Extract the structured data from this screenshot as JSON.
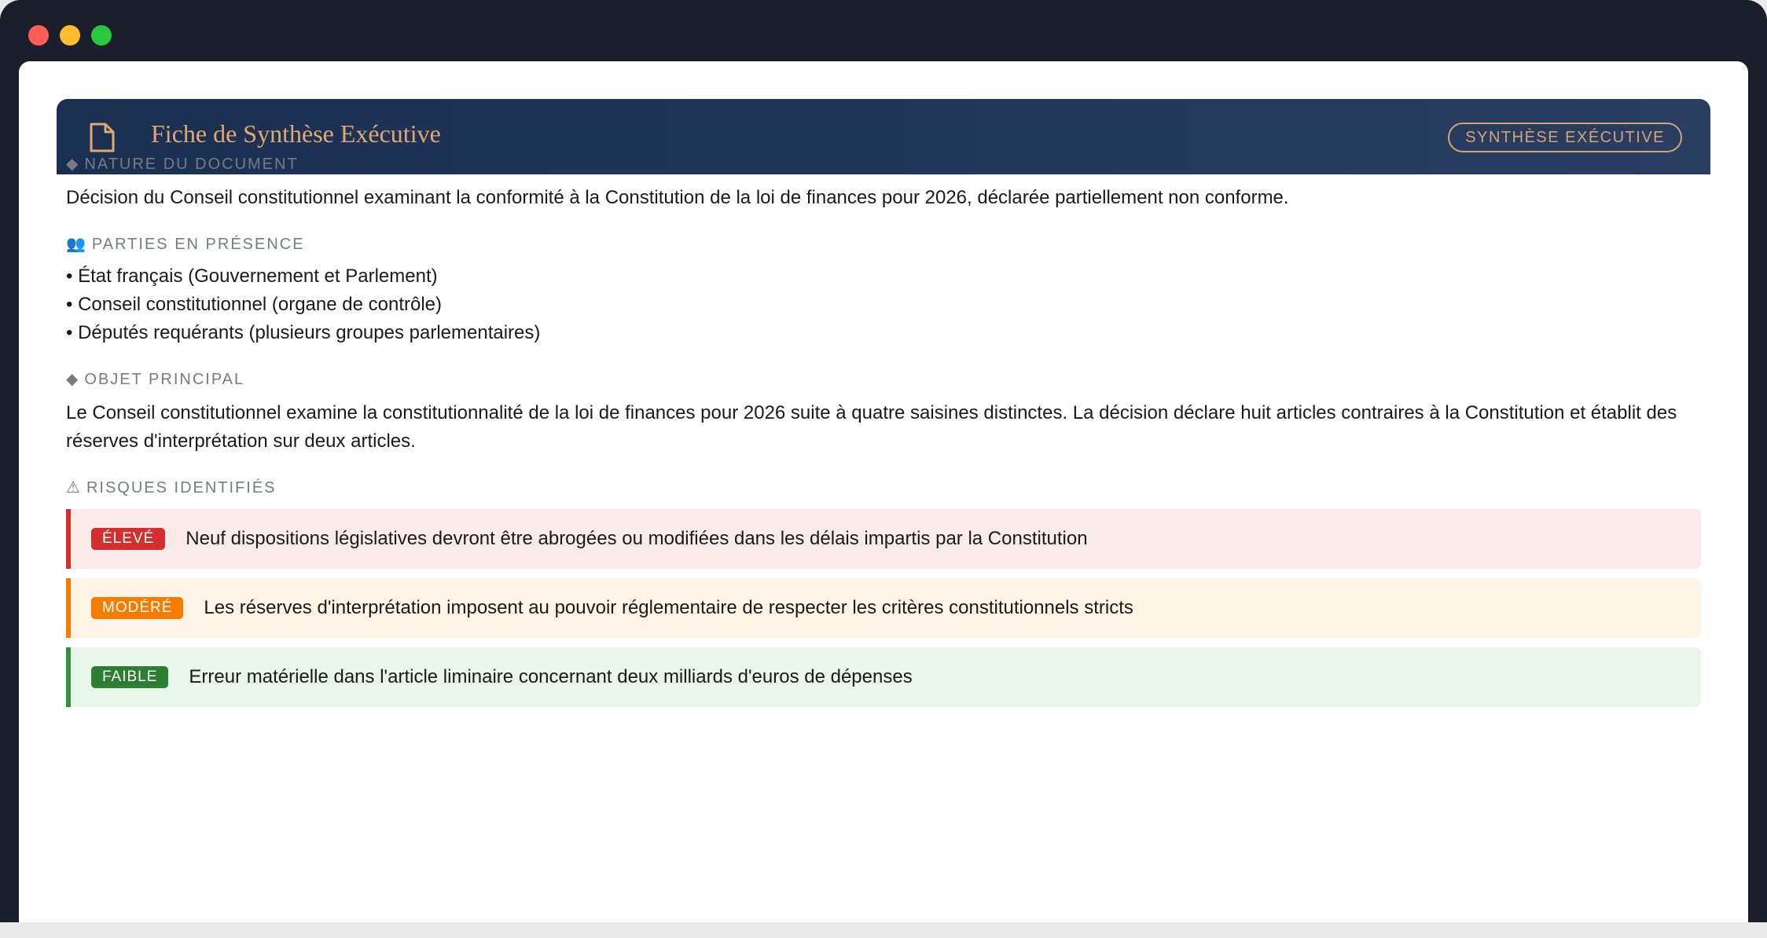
{
  "header": {
    "title": "Fiche de Synthèse Exécutive",
    "badge": "SYNTHÈSE EXÉCUTIVE",
    "icon": "document-icon"
  },
  "sections": {
    "nature": {
      "glyph": "◆",
      "label": "NATURE DU DOCUMENT",
      "text": "Décision du Conseil constitutionnel examinant la conformité à la Constitution de la loi de finances pour 2026, déclarée partiellement non conforme."
    },
    "parties": {
      "glyph": "👥",
      "label": "PARTIES EN PRÉSENCE",
      "items": [
        "• État français (Gouvernement et Parlement)",
        "• Conseil constitutionnel (organe de contrôle)",
        "• Députés requérants (plusieurs groupes parlementaires)"
      ]
    },
    "objet": {
      "glyph": "◆",
      "label": "OBJET PRINCIPAL",
      "text": "Le Conseil constitutionnel examine la constitutionnalité de la loi de finances pour 2026 suite à quatre saisines distinctes. La décision déclare huit articles contraires à la Constitution et établit des réserves d'interprétation sur deux articles."
    },
    "risques": {
      "glyph": "⚠",
      "label": "RISQUES IDENTIFIÉS",
      "items": [
        {
          "level": "ÉLEVÉ",
          "text": "Neuf dispositions législatives devront être abrogées ou modifiées dans les délais impartis par la Constitution",
          "color": "#d32f2f"
        },
        {
          "level": "MODÉRÉ",
          "text": "Les réserves d'interprétation imposent au pouvoir réglementaire de respecter les critères constitutionnels stricts",
          "color": "#f57c00"
        },
        {
          "level": "FAIBLE",
          "text": "Erreur matérielle dans l'article liminaire concernant deux milliards d'euros de dépenses",
          "color": "#2e7d32"
        }
      ]
    }
  },
  "colors": {
    "header_bg": "#1b2f52",
    "header_title": "#e0a872",
    "window_chrome": "#1b1e2b"
  }
}
